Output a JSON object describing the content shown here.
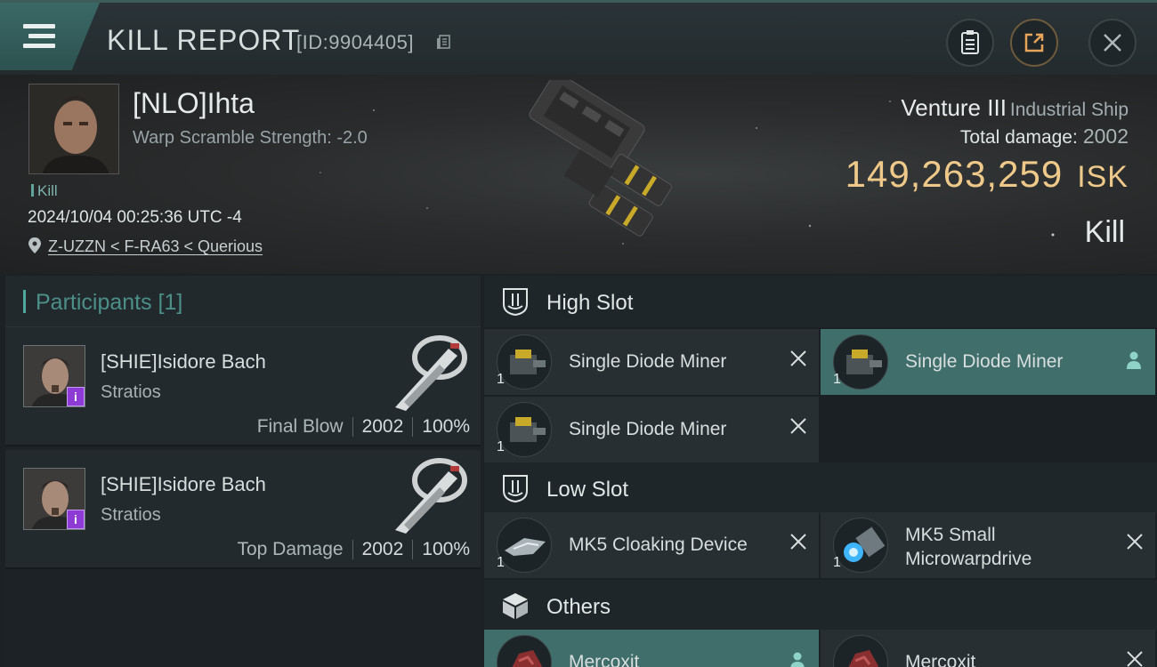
{
  "header": {
    "title": "KILL REPORT",
    "report_id": "[ID:9904405]"
  },
  "victim": {
    "name": "[NLO]Ihta",
    "warp_scramble": "Warp Scramble Strength: -2.0",
    "tag": "Kill",
    "timestamp": "2024/10/04 00:25:36 UTC -4",
    "location": "Z-UZZN < F-RA63 < Querious",
    "ship_name": "Venture III",
    "ship_class": "Industrial Ship",
    "total_damage_label": "Total damage:",
    "total_damage": "2002",
    "isk_value": "149,263,259",
    "isk_unit": "ISK",
    "result": "Kill"
  },
  "participants": {
    "header": "Participants [1]",
    "items": [
      {
        "name": "[SHIE]Isidore Bach",
        "ship": "Stratios",
        "role": "Final Blow",
        "damage": "2002",
        "percent": "100%",
        "badge": "i"
      },
      {
        "name": "[SHIE]Isidore Bach",
        "ship": "Stratios",
        "role": "Top Damage",
        "damage": "2002",
        "percent": "100%",
        "badge": "i"
      }
    ]
  },
  "fitting": {
    "high_slot": {
      "label": "High Slot",
      "modules": [
        {
          "name": "Single Diode Miner",
          "qty": "1",
          "highlighted": false
        },
        {
          "name": "Single Diode Miner",
          "qty": "1",
          "highlighted": true
        },
        {
          "name": "Single Diode Miner",
          "qty": "1",
          "highlighted": false
        }
      ]
    },
    "low_slot": {
      "label": "Low Slot",
      "modules": [
        {
          "name": "MK5 Cloaking Device",
          "qty": "1"
        },
        {
          "name": "MK5 Small Microwarpdrive",
          "qty": "1"
        }
      ]
    },
    "others": {
      "label": "Others",
      "modules": [
        {
          "name": "Mercoxit",
          "qty": "",
          "highlighted": true
        },
        {
          "name": "Mercoxit",
          "qty": "",
          "highlighted": false
        }
      ]
    }
  },
  "colors": {
    "accent": "#4fa79d",
    "isk": "#eec98a",
    "highlight_row": "#3f6e6b",
    "badge": "#8e3bd6"
  }
}
